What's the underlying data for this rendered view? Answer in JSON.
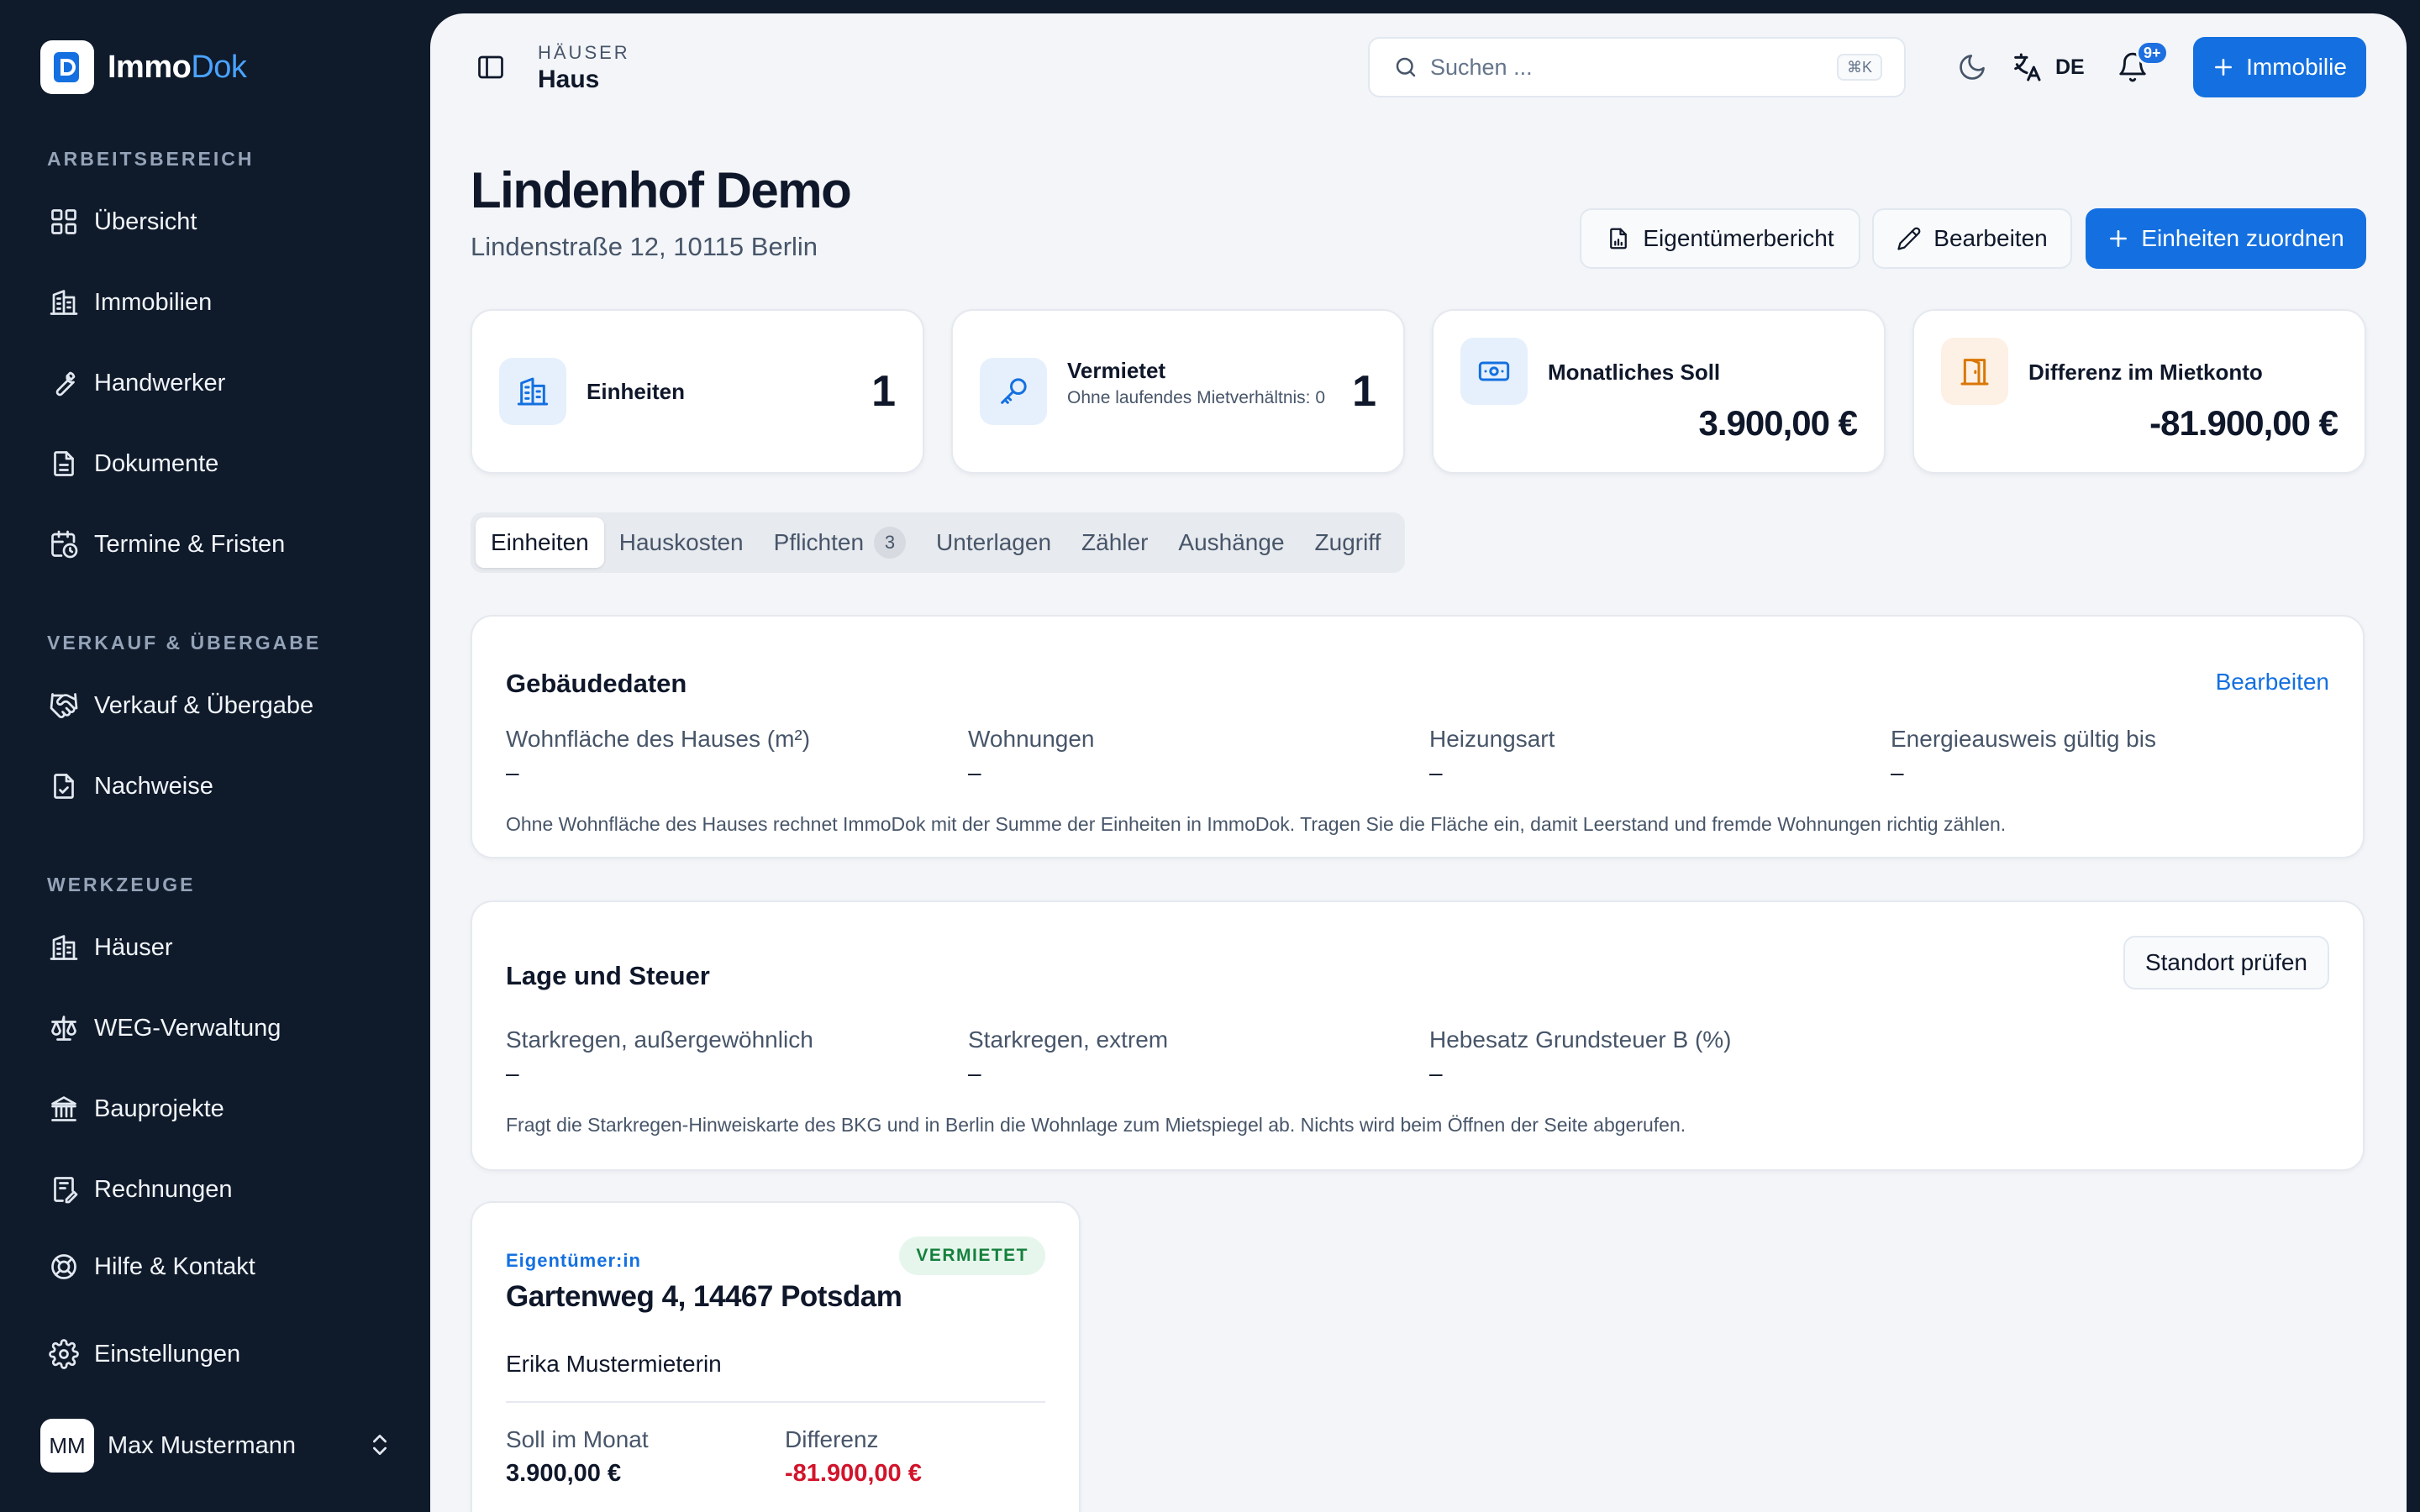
{
  "brand": {
    "name_part1": "Immo",
    "name_part2": "Dok"
  },
  "sidebar": {
    "sections": [
      {
        "label": "ARBEITSBEREICH",
        "items": [
          {
            "label": "Übersicht",
            "icon": "dashboard-icon"
          },
          {
            "label": "Immobilien",
            "icon": "building-icon"
          },
          {
            "label": "Handwerker",
            "icon": "wrench-icon"
          },
          {
            "label": "Dokumente",
            "icon": "document-icon"
          },
          {
            "label": "Termine & Fristen",
            "icon": "calendar-clock-icon"
          }
        ]
      },
      {
        "label": "VERKAUF & ÜBERGABE",
        "items": [
          {
            "label": "Verkauf & Übergabe",
            "icon": "handshake-icon"
          },
          {
            "label": "Nachweise",
            "icon": "file-check-icon"
          }
        ]
      },
      {
        "label": "WERKZEUGE",
        "items": [
          {
            "label": "Häuser",
            "icon": "buildings-icon"
          },
          {
            "label": "WEG-Verwaltung",
            "icon": "scale-icon"
          },
          {
            "label": "Bauprojekte",
            "icon": "landmark-icon"
          },
          {
            "label": "Rechnungen",
            "icon": "receipt-icon"
          },
          {
            "label": "Hilfe & Kontakt",
            "icon": "lifebuoy-icon"
          },
          {
            "label": "Einstellungen",
            "icon": "gear-icon"
          }
        ]
      }
    ],
    "user": {
      "initials": "MM",
      "name": "Max Mustermann"
    }
  },
  "topbar": {
    "breadcrumb_parent": "HÄUSER",
    "breadcrumb_current": "Haus",
    "search_placeholder": "Suchen ...",
    "search_shortcut": "⌘K",
    "language": "DE",
    "notification_badge": "9+",
    "new_property_label": "Immobilie"
  },
  "header": {
    "title": "Lindenhof Demo",
    "address": "Lindenstraße 12, 10115 Berlin",
    "actions": {
      "owner_report": "Eigentümerbericht",
      "edit": "Bearbeiten",
      "assign_units": "Einheiten zuordnen"
    }
  },
  "stats": {
    "units": {
      "label": "Einheiten",
      "value": "1"
    },
    "rented": {
      "label": "Vermietet",
      "note": "Ohne laufendes Mietverhältnis: 0",
      "value": "1"
    },
    "monthly_target": {
      "label": "Monatliches Soll",
      "value": "3.900,00 €"
    },
    "rent_account_diff": {
      "label": "Differenz im Mietkonto",
      "value": "-81.900,00 €"
    }
  },
  "tabs": [
    {
      "label": "Einheiten",
      "active": true
    },
    {
      "label": "Hauskosten"
    },
    {
      "label": "Pflichten",
      "count": "3"
    },
    {
      "label": "Unterlagen"
    },
    {
      "label": "Zähler"
    },
    {
      "label": "Aushänge"
    },
    {
      "label": "Zugriff"
    }
  ],
  "building_data": {
    "title": "Gebäudedaten",
    "edit_label": "Bearbeiten",
    "fields": [
      {
        "label": "Wohnfläche des Hauses (m²)",
        "value": "–"
      },
      {
        "label": "Wohnungen",
        "value": "–"
      },
      {
        "label": "Heizungsart",
        "value": "–"
      },
      {
        "label": "Energieausweis gültig bis",
        "value": "–"
      }
    ],
    "note": "Ohne Wohnfläche des Hauses rechnet ImmoDok mit der Summe der Einheiten in ImmoDok. Tragen Sie die Fläche ein, damit Leerstand und fremde Wohnungen richtig zählen."
  },
  "location_tax": {
    "title": "Lage und Steuer",
    "check_label": "Standort prüfen",
    "fields": [
      {
        "label": "Starkregen, außergewöhnlich",
        "value": "–"
      },
      {
        "label": "Starkregen, extrem",
        "value": "–"
      },
      {
        "label": "Hebesatz Grundsteuer B (%)",
        "value": "–"
      }
    ],
    "note": "Fragt die Starkregen-Hinweiskarte des BKG und in Berlin die Wohnlage zum Mietspiegel ab. Nichts wird beim Öffnen der Seite abgerufen."
  },
  "unit_card": {
    "owner_label": "Eigentümer:in",
    "status": "VERMIETET",
    "address": "Gartenweg 4, 14467 Potsdam",
    "tenant": "Erika Mustermieterin",
    "target_label": "Soll im Monat",
    "target_value": "3.900,00 €",
    "diff_label": "Differenz",
    "diff_value": "-81.900,00 €"
  },
  "colors": {
    "sidebar_bg": "#0f1a2b",
    "accent": "#1470e0",
    "negative": "#d1142b",
    "positive_badge": "#15803d"
  }
}
